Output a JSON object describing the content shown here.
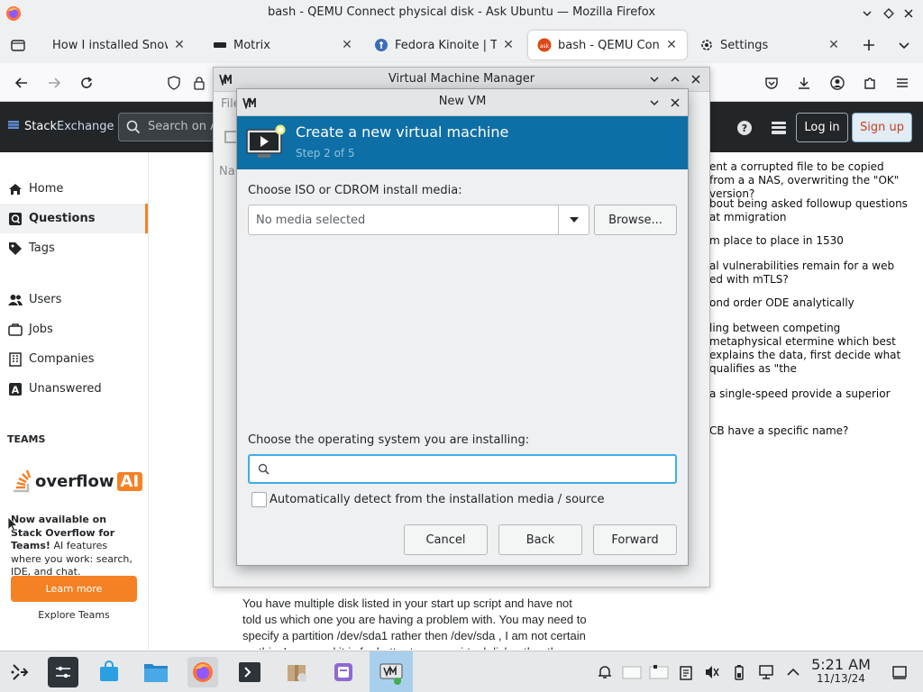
{
  "window": {
    "title": "bash - QEMU Connect physical disk - Ask Ubuntu — Mozilla Firefox"
  },
  "tabs": [
    {
      "label": "How I installed Snow L",
      "active": false
    },
    {
      "label": "Motrix",
      "active": false
    },
    {
      "label": "Fedora Kinoite | Th",
      "active": false
    },
    {
      "label": "bash - QEMU Conn",
      "active": true
    },
    {
      "label": "Settings",
      "active": false
    }
  ],
  "stackexchange": {
    "logo_a": "Stack",
    "logo_b": "Exchange",
    "search_placeholder": "Search on A",
    "login": "Log in",
    "signup": "Sign up"
  },
  "leftnav": {
    "items": [
      {
        "label": "Home",
        "icon": "home-icon"
      },
      {
        "label": "Questions",
        "icon": "questions-icon"
      },
      {
        "label": "Tags",
        "icon": "tag-icon"
      },
      {
        "label": "Users",
        "icon": "users-icon"
      },
      {
        "label": "Jobs",
        "icon": "briefcase-icon"
      },
      {
        "label": "Companies",
        "icon": "building-icon"
      },
      {
        "label": "Unanswered",
        "icon": "unanswered-icon"
      }
    ],
    "teams_heading": "TEAMS",
    "overflow_ai": "overflow",
    "overflow_ai_suffix": "AI",
    "teams_text_bold": "Now available on Stack Overflow for Teams!",
    "teams_text": " AI features where you work: search, IDE, and chat.",
    "learn_more": "Learn more",
    "explore_teams": "Explore Teams"
  },
  "hot_questions": [
    "ent a corrupted file to be copied from a a NAS, overwriting the \"OK\" version?",
    "bout being asked followup questions at mmigration",
    "m place to place in 1530",
    "al vulnerabilities remain for a web ed with mTLS?",
    "ond order ODE analytically",
    "ling between competing metaphysical etermine which best explains the data, first decide what qualifies as \"the",
    "a single-speed provide a superior",
    "CB have a specific name?"
  ],
  "vmm": {
    "title": "Virtual Machine Manager",
    "menu_file": "File",
    "na": "Na"
  },
  "newvm": {
    "title": "New VM",
    "heading": "Create a new virtual machine",
    "step": "Step 2 of 5",
    "iso_label": "Choose ISO or CDROM install media:",
    "iso_placeholder": "No media selected",
    "browse": "Browse...",
    "os_label": "Choose the operating system you are installing:",
    "os_value": "",
    "autodetect": "Automatically detect from the installation media / source",
    "autodetect_checked": false,
    "cancel": "Cancel",
    "back": "Back",
    "forward": "Forward"
  },
  "answer_text": "You have multiple disk listed in your start up script and have not told us which one you are having a problem with. You may need to specify a partition /dev/sda1 rather then /dev/sda , I am not certain on this. In general it is far better to use a virtual disk rather then a",
  "taskbar": {
    "clock_time": "5:21 AM",
    "clock_date": "11/13/24"
  },
  "colors": {
    "banner": "#0e6fa6",
    "accent_orange": "#f48225",
    "focus_blue": "#3daee9",
    "signup_bg": "#e1ecf4"
  }
}
